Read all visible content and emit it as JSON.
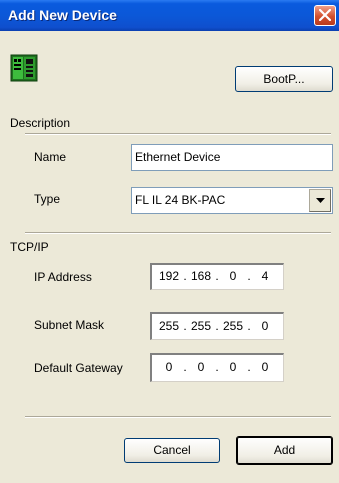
{
  "window": {
    "title": "Add New Device"
  },
  "toolbar": {
    "bootp_label": "BootP..."
  },
  "description": {
    "section_label": "Description",
    "name_label": "Name",
    "name_value": "Ethernet Device",
    "type_label": "Type",
    "type_value": "FL IL 24 BK-PAC"
  },
  "tcpip": {
    "section_label": "TCP/IP",
    "ip_label": "IP Address",
    "ip_octets": [
      "192",
      "168",
      "0",
      "4"
    ],
    "mask_label": "Subnet Mask",
    "mask_octets": [
      "255",
      "255",
      "255",
      "0"
    ],
    "gateway_label": "Default Gateway",
    "gateway_octets": [
      "0",
      "0",
      "0",
      "0"
    ]
  },
  "footer": {
    "cancel_label": "Cancel",
    "add_label": "Add"
  },
  "icons": {
    "device": "network-device-icon",
    "close": "close-icon",
    "dropdown": "chevron-down-icon"
  },
  "colors": {
    "titlebar": "#0b58d8",
    "close_button": "#d3502e",
    "dialog_bg": "#ece9d8",
    "device_green": "#2e9b2e"
  }
}
